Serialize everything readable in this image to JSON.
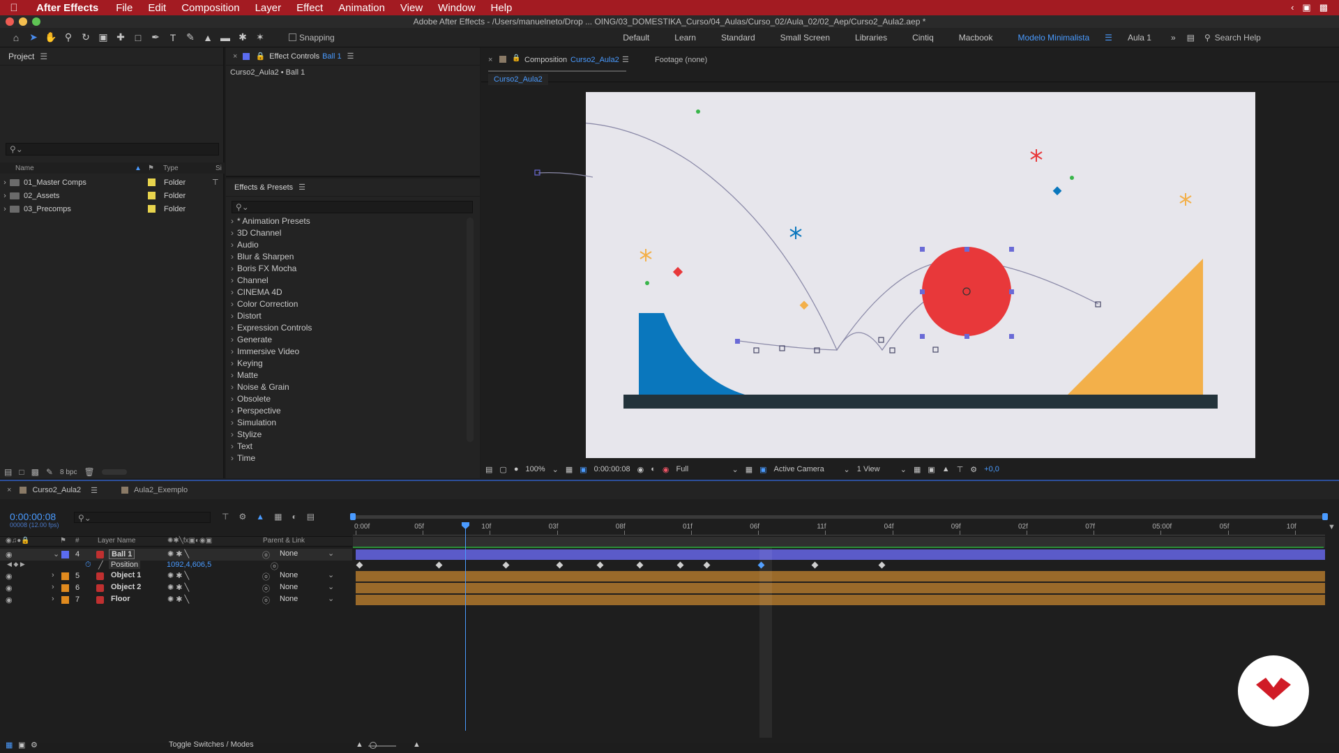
{
  "menubar": {
    "app": "After Effects",
    "items": [
      "File",
      "Edit",
      "Composition",
      "Layer",
      "Effect",
      "Animation",
      "View",
      "Window",
      "Help"
    ]
  },
  "window_title": "Adobe After Effects - /Users/manuelneto/Drop ... OING/03_DOMESTIKA_Curso/04_Aulas/Curso_02/Aula_02/02_Aep/Curso2_Aula2.aep *",
  "toolbar": {
    "snapping_label": "Snapping",
    "workspaces": [
      "Default",
      "Learn",
      "Standard",
      "Small Screen",
      "Libraries",
      "Cintiq",
      "Macbook",
      "Modelo Minimalista",
      "Aula 1"
    ],
    "active_workspace": "Modelo Minimalista",
    "search_placeholder": "Search Help"
  },
  "project": {
    "title": "Project",
    "columns": {
      "name": "Name",
      "type": "Type",
      "size": "Si"
    },
    "items": [
      {
        "name": "01_Master Comps",
        "type": "Folder"
      },
      {
        "name": "02_Assets",
        "type": "Folder"
      },
      {
        "name": "03_Precomps",
        "type": "Folder"
      }
    ],
    "bpc": "8 bpc"
  },
  "effect_controls": {
    "title_prefix": "Effect Controls",
    "layer": "Ball 1",
    "breadcrumb": "Curso2_Aula2 • Ball 1"
  },
  "effects_presets": {
    "title": "Effects & Presets",
    "items": [
      "* Animation Presets",
      "3D Channel",
      "Audio",
      "Blur & Sharpen",
      "Boris FX Mocha",
      "Channel",
      "CINEMA 4D",
      "Color Correction",
      "Distort",
      "Expression Controls",
      "Generate",
      "Immersive Video",
      "Keying",
      "Matte",
      "Noise & Grain",
      "Obsolete",
      "Perspective",
      "Simulation",
      "Stylize",
      "Text",
      "Time"
    ]
  },
  "composition": {
    "title_prefix": "Composition",
    "name": "Curso2_Aula2",
    "footage": "Footage (none)",
    "tab": "Curso2_Aula2",
    "zoom": "100%",
    "timecode": "0:00:00:08",
    "resolution": "Full",
    "camera": "Active Camera",
    "views": "1 View",
    "exposure": "+0,0"
  },
  "timeline": {
    "tabs": [
      "Curso2_Aula2",
      "Aula2_Exemplo"
    ],
    "timecode": "0:00:00:08",
    "frame_info": "00008 (12.00 fps)",
    "ruler": [
      "0:00f",
      "05f",
      "10f",
      "03f",
      "08f",
      "01f",
      "06f",
      "11f",
      "04f",
      "09f",
      "02f",
      "07f",
      "05:00f",
      "05f",
      "10f"
    ],
    "columns": {
      "layer_name": "Layer Name",
      "parent": "Parent & Link",
      "num": "#"
    },
    "layers": [
      {
        "num": "4",
        "name": "Ball 1",
        "parent": "None",
        "color": "#5b6cf0"
      },
      {
        "num": "5",
        "name": "Object 1",
        "parent": "None",
        "color": "#e08a1e"
      },
      {
        "num": "6",
        "name": "Object 2",
        "parent": "None",
        "color": "#e08a1e"
      },
      {
        "num": "7",
        "name": "Floor",
        "parent": "None",
        "color": "#e08a1e"
      }
    ],
    "position_label": "Position",
    "position_value": "1092,4,606,5",
    "toggle_label": "Toggle Switches / Modes"
  },
  "colors": {
    "menubar": "#a31b22",
    "accent": "#4a9bff",
    "ball": "#e8383a",
    "blue_shape": "#0a77bd",
    "yellow_shape": "#f3b04a",
    "floor": "#23333b",
    "layer_bar_blue": "#5b5bc9",
    "layer_bar_orange": "#9a6a2a"
  }
}
